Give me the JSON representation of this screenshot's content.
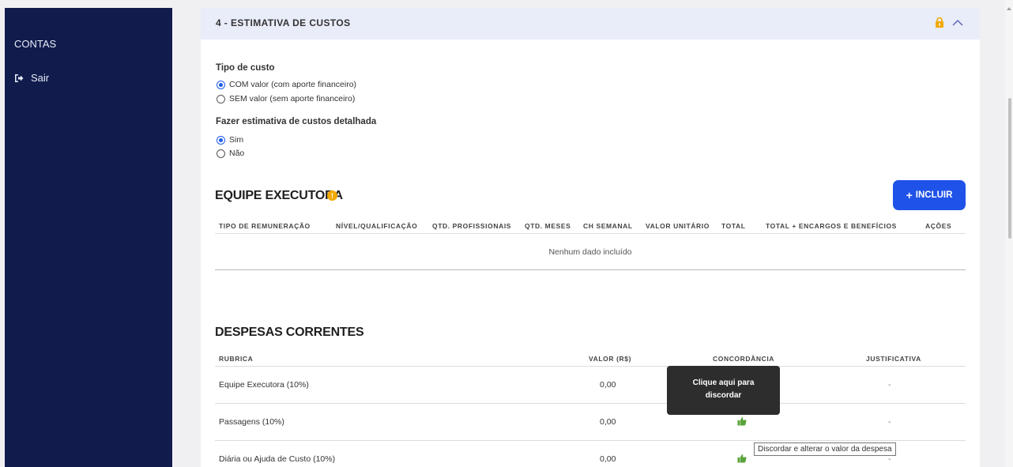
{
  "sidebar": {
    "contas": "CONTAS",
    "sair": "Sair",
    "sair_icon": "sign-out-icon"
  },
  "section": {
    "title": "4 - ESTIMATIVA DE CUSTOS",
    "icons": [
      "lock-icon",
      "chevron-up-icon"
    ]
  },
  "tipo_custo": {
    "label": "Tipo de custo",
    "options": [
      {
        "label": "COM valor (com aporte financeiro)",
        "selected": true
      },
      {
        "label": "SEM valor (sem aporte financeiro)",
        "selected": false
      }
    ]
  },
  "estimativa": {
    "label": "Fazer estimativa de custos detalhada",
    "options": [
      {
        "label": "Sim",
        "selected": true
      },
      {
        "label": "Não",
        "selected": false
      }
    ]
  },
  "equipe": {
    "title": "EQUIPE EXECUTORA",
    "info_icon": "!",
    "incluir_button": "INCLUIR",
    "columns": [
      "TIPO DE REMUNERAÇÃO",
      "NÍVEL/QUALIFICAÇÃO",
      "QTD. PROFISSIONAIS",
      "QTD. MESES",
      "CH SEMANAL",
      "VALOR UNITÁRIO",
      "TOTAL",
      "TOTAL + ENCARGOS E BENEFÍCIOS",
      "AÇÕES"
    ],
    "empty_text": "Nenhum dado incluído"
  },
  "despesas": {
    "title": "DESPESAS CORRENTES",
    "columns": [
      "RUBRICA",
      "VALOR (R$)",
      "CONCORDÂNCIA",
      "JUSTIFICATIVA"
    ],
    "rows": [
      {
        "rubrica": "Equipe Executora (10%)",
        "valor": "0,00",
        "justificativa": "-"
      },
      {
        "rubrica": "Passagens (10%)",
        "valor": "0,00",
        "justificativa": "-"
      },
      {
        "rubrica": "Diária ou Ajuda de Custo (10%)",
        "valor": "0,00",
        "justificativa": "-"
      }
    ]
  },
  "tooltip": {
    "line1": "Clique aqui para",
    "line2": "discordar"
  },
  "title_tooltip": "Discordar e alterar o valor da despesa",
  "colors": {
    "sidebar": "#111c4d",
    "header": "#e9ecf9",
    "primary": "#1f52e8",
    "thumb": "#5aa33a",
    "lock": "#f2a900"
  }
}
